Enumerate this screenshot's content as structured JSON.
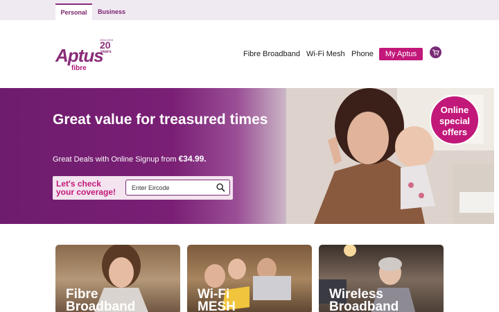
{
  "segments": {
    "personal": "Personal",
    "business": "Business"
  },
  "logo": {
    "word": "Aptus",
    "sub": "fibre",
    "years_small": "2004-2024",
    "years_num": "20",
    "years_label": "years"
  },
  "nav": {
    "fibre": "Fibre Broadband",
    "mesh": "Wi-Fi Mesh",
    "phone": "Phone",
    "myaptus": "My Aptus",
    "cart_icon": "cart-icon"
  },
  "hero": {
    "title": "Great value for treasured times",
    "sub_prefix": "Great Deals with Online Signup from ",
    "price": "€34.99.",
    "coverage_line1": "Let's check",
    "coverage_line2": "your coverage!",
    "eircode_placeholder": "Enter Eircode",
    "badge_line1": "Online",
    "badge_line2": "special",
    "badge_line3": "offers"
  },
  "cards": [
    {
      "line1": "Fibre",
      "line2": "Broadband"
    },
    {
      "line1": "Wi-Fi",
      "line2": "MESH"
    },
    {
      "line1": "Wireless",
      "line2": "Broadband"
    }
  ],
  "colors": {
    "accent": "#c2187a",
    "brand": "#7a2a75"
  }
}
